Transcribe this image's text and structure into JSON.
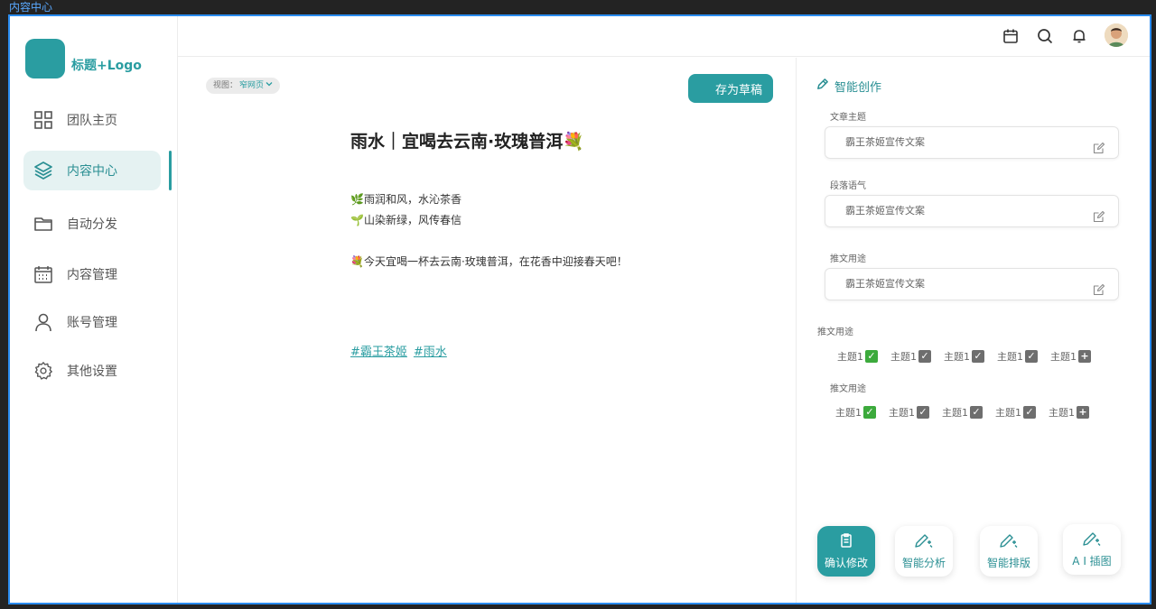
{
  "window": {
    "title": "内容中心"
  },
  "brand": {
    "logo_text": "标题+Logo",
    "accent": "#2a9da1"
  },
  "sidebar": {
    "items": [
      {
        "label": "团队主页",
        "icon": "grid-icon"
      },
      {
        "label": "内容中心",
        "icon": "layers-icon",
        "active": true
      },
      {
        "label": "自动分发",
        "icon": "folder-icon"
      },
      {
        "label": "内容管理",
        "icon": "calendar-grid-icon"
      },
      {
        "label": "账号管理",
        "icon": "user-icon"
      },
      {
        "label": "其他设置",
        "icon": "gear-icon"
      }
    ]
  },
  "header": {
    "icons": [
      "calendar-icon",
      "search-icon",
      "bell-icon",
      "avatar"
    ]
  },
  "editor": {
    "view_label": "视图：",
    "view_value": "窄网页",
    "save_label": "存为草稿",
    "title": "雨水｜宜喝去云南·玫瑰普洱💐",
    "lines": [
      "🌿雨润和风，水沁茶香",
      "🌱山染新绿，风传春信",
      "💐今天宜喝一杯去云南·玫瑰普洱，在花香中迎接春天吧！"
    ],
    "tags": [
      "#霸王茶姬",
      "#雨水"
    ]
  },
  "panel": {
    "heading": "智能创作",
    "fields": [
      {
        "label": "文章主题",
        "value": "霸王茶姬宣传文案"
      },
      {
        "label": "段落语气",
        "value": "霸王茶姬宣传文案"
      },
      {
        "label": "推文用途",
        "value": "霸王茶姬宣传文案"
      }
    ],
    "topic_groups": [
      {
        "label": "推文用途",
        "topics": [
          {
            "label": "主题1",
            "state": "checked-green"
          },
          {
            "label": "主题1",
            "state": "checked-gray"
          },
          {
            "label": "主题1",
            "state": "checked-gray"
          },
          {
            "label": "主题1",
            "state": "checked-gray"
          },
          {
            "label": "主题1",
            "state": "add"
          }
        ]
      },
      {
        "label": "推文用途",
        "topics": [
          {
            "label": "主题1",
            "state": "checked-green"
          },
          {
            "label": "主题1",
            "state": "checked-gray"
          },
          {
            "label": "主题1",
            "state": "checked-gray"
          },
          {
            "label": "主题1",
            "state": "checked-gray"
          },
          {
            "label": "主题1",
            "state": "add"
          }
        ]
      }
    ],
    "actions": [
      {
        "label": "确认修改",
        "icon": "clipboard-icon",
        "primary": true
      },
      {
        "label": "智能分析",
        "icon": "magic-pen-icon"
      },
      {
        "label": "智能排版",
        "icon": "magic-pen-icon"
      },
      {
        "label": "A I 插图",
        "icon": "magic-pen-icon"
      }
    ]
  }
}
